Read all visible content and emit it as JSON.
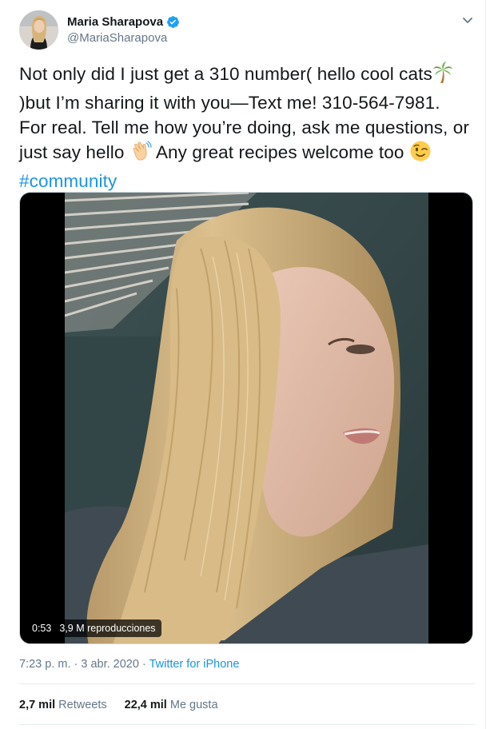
{
  "author": {
    "display_name": "Maria Sharapova",
    "handle": "@MariaSharapova",
    "verified": true
  },
  "tweet": {
    "lines": [
      "Not only did I just get a 310 number( hello cool cats",
      ")but I’m sharing it with you—Text me! 310-564-7981.",
      "For real. Tell me how you’re doing, ask me questions, or",
      "just say hello",
      " Any great recipes welcome too "
    ],
    "hashtag": "#community",
    "emojis": [
      "palm-tree",
      "waving-hand",
      "winking-face"
    ]
  },
  "video": {
    "duration": "0:53",
    "views": "3,9 M reproducciones"
  },
  "meta": {
    "timestamp": "7:23 p. m. · 3 abr. 2020",
    "separator": " · ",
    "source": "Twitter for iPhone"
  },
  "stats": {
    "retweets_count": "2,7 mil",
    "retweets_label": "Retweets",
    "likes_count": "22,4 mil",
    "likes_label": "Me gusta"
  },
  "colors": {
    "link": "#1b95e0",
    "muted": "#657786",
    "verified": "#1da1f2"
  }
}
